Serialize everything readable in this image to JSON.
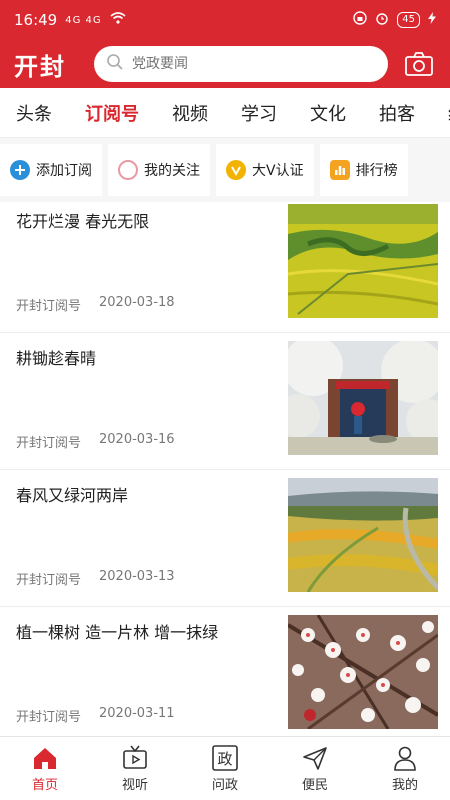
{
  "status_bar": {
    "time": "16:49",
    "signal": "4G 4G",
    "battery": "45"
  },
  "header": {
    "logo": "开封",
    "search_placeholder": "党政要闻"
  },
  "tabs": [
    {
      "label": "头条"
    },
    {
      "label": "订阅号",
      "active": true
    },
    {
      "label": "视频"
    },
    {
      "label": "学习"
    },
    {
      "label": "文化"
    },
    {
      "label": "拍客"
    },
    {
      "label": "经"
    }
  ],
  "actions": [
    {
      "label": "添加订阅",
      "icon": "add-icon",
      "color": "#2a8fd9"
    },
    {
      "label": "我的关注",
      "icon": "circle-icon",
      "color": "#e89aa5"
    },
    {
      "label": "大V认证",
      "icon": "verified-icon",
      "color": "#f2b400"
    },
    {
      "label": "排行榜",
      "icon": "ranking-icon",
      "color": "#f3a31f"
    }
  ],
  "feed": [
    {
      "title": "花开烂漫 春光无限",
      "source": "开封订阅号",
      "date": "2020-03-18"
    },
    {
      "title": "耕锄趁春晴",
      "source": "开封订阅号",
      "date": "2020-03-16"
    },
    {
      "title": "春风又绿河两岸",
      "source": "开封订阅号",
      "date": "2020-03-13"
    },
    {
      "title": "植一棵树 造一片林 增一抹绿",
      "source": "开封订阅号",
      "date": "2020-03-11"
    }
  ],
  "bottom_nav": [
    {
      "label": "首页",
      "icon": "home-icon",
      "active": true
    },
    {
      "label": "视听",
      "icon": "tv-icon"
    },
    {
      "label": "问政",
      "icon": "politics-icon",
      "glyph": "政"
    },
    {
      "label": "便民",
      "icon": "send-icon"
    },
    {
      "label": "我的",
      "icon": "user-icon"
    }
  ],
  "colors": {
    "brand": "#d9282f"
  }
}
